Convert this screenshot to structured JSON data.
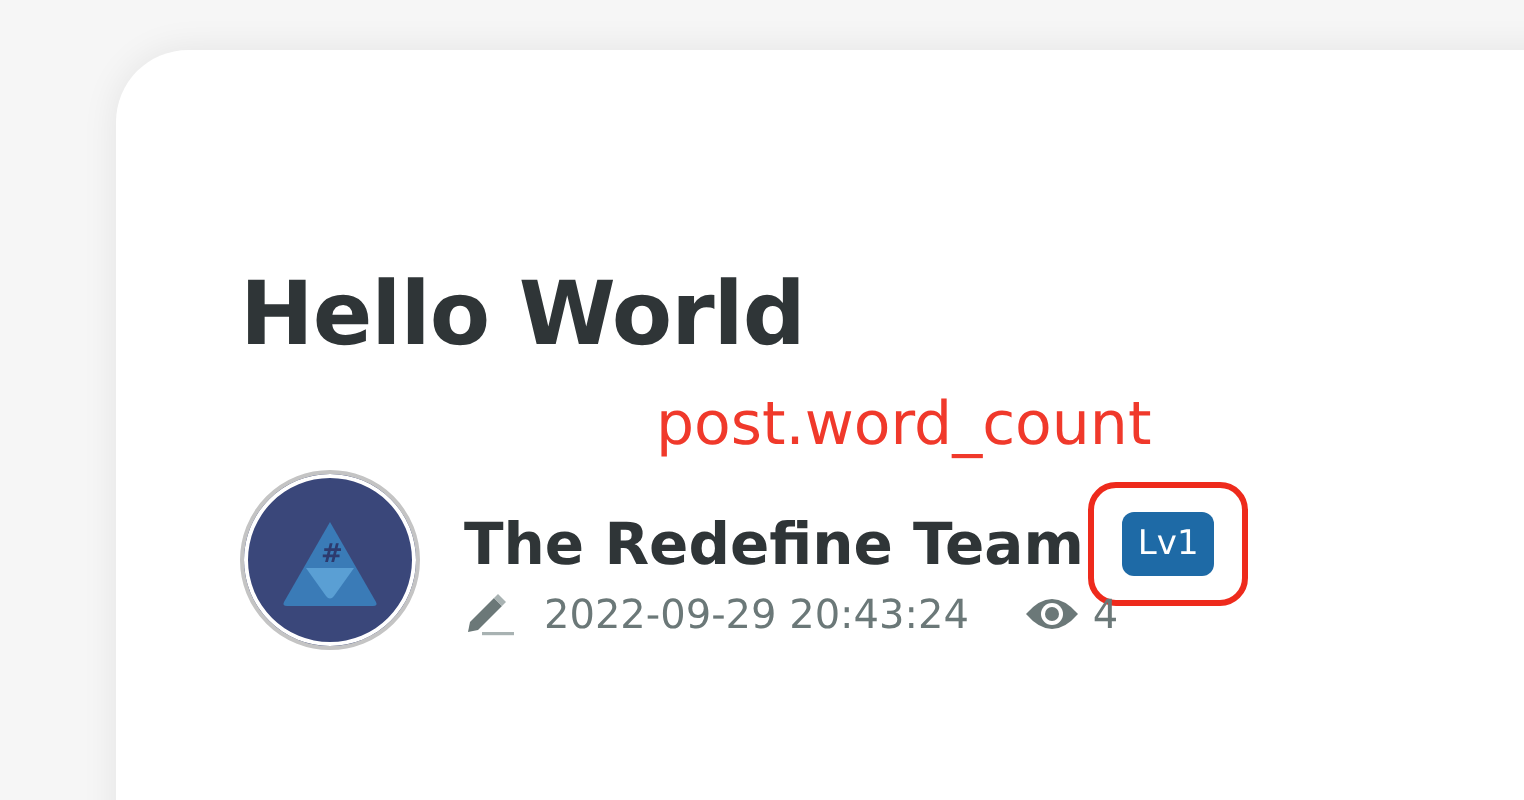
{
  "post": {
    "title": "Hello World",
    "annotation": "post.word_count",
    "author": {
      "name": "The Redefine Team",
      "avatar_mark": "#",
      "level_badge": "Lv1",
      "badge_highlighted": true
    },
    "date": "2022-09-29 20:43:24",
    "views": "4"
  }
}
